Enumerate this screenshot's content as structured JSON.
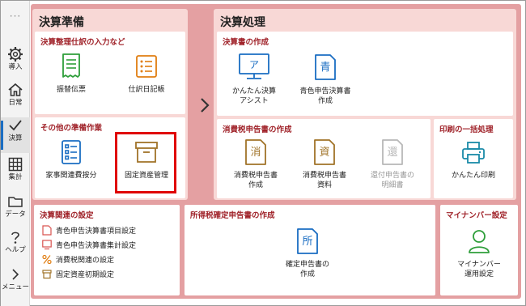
{
  "sidebar": {
    "menu_icon": "more-dots-icon",
    "items": [
      {
        "label": "導入",
        "icon": "gear-icon"
      },
      {
        "label": "日常",
        "icon": "home-icon"
      },
      {
        "label": "決算",
        "icon": "check-icon"
      },
      {
        "label": "集計",
        "icon": "table-icon"
      },
      {
        "label": "データ",
        "icon": "folder-icon"
      },
      {
        "label": "ヘルプ",
        "icon": "help-icon"
      },
      {
        "label": "メニュー",
        "icon": "chevron-right-icon"
      }
    ],
    "active": "決算"
  },
  "kessan_junbi": {
    "title": "決算準備",
    "siwake": {
      "title": "決算整理仕訳の入力など",
      "tiles": [
        {
          "label": "振替伝票",
          "icon": "receipt-icon"
        },
        {
          "label": "仕訳日記帳",
          "icon": "journal-list-icon"
        }
      ]
    },
    "other": {
      "title": "その他の準備作業",
      "tiles": [
        {
          "label": "家事関連費按分",
          "icon": "checklist-icon"
        },
        {
          "label": "固定資産管理",
          "icon": "box-icon"
        }
      ]
    }
  },
  "kessan_shori": {
    "title": "決算処理",
    "sakusei": {
      "title": "決算書の作成",
      "tiles": [
        {
          "label": "かんたん決算\nアシスト",
          "glyph": "ア",
          "icon": "monitor-icon"
        },
        {
          "label": "青色申告決算書\n作成",
          "glyph": "青",
          "icon": "document-icon"
        }
      ]
    },
    "shohizei": {
      "title": "消費税申告書の作成",
      "tiles": [
        {
          "label": "消費税申告書\n作成",
          "glyph": "消",
          "icon": "document-icon"
        },
        {
          "label": "消費税申告書\n資料",
          "glyph": "資",
          "icon": "document-icon"
        },
        {
          "label": "還付申告書の\n明細書",
          "glyph": "還",
          "icon": "document-icon",
          "disabled": true
        }
      ]
    },
    "print": {
      "title": "印刷の一括処理",
      "tiles": [
        {
          "label": "かんたん印刷",
          "icon": "printer-icon"
        }
      ]
    }
  },
  "bottom": {
    "settings": {
      "title": "決算関連の設定",
      "links": [
        {
          "label": "青色申告決算書項目設定",
          "icon": "document-edit-icon"
        },
        {
          "label": "青色申告決算書集計設定",
          "icon": "screen-edit-icon"
        },
        {
          "label": "消費税関連の設定",
          "icon": "percent-icon"
        },
        {
          "label": "固定資産初期設定",
          "icon": "box-small-icon"
        }
      ]
    },
    "shotoku": {
      "title": "所得税確定申告書の作成",
      "tiles": [
        {
          "label": "確定申告書の\n作成",
          "glyph": "所",
          "icon": "document-icon"
        }
      ]
    },
    "mynumber": {
      "title": "マイナンバー設定",
      "tiles": [
        {
          "label": "マイナンバー\n運用設定",
          "icon": "person-icon"
        }
      ]
    }
  },
  "colors": {
    "main_bg": "#e4a0a2",
    "section_bg": "#f8d8d6",
    "panel_title": "#a0232a",
    "icon_blue": "#1a6dc2",
    "icon_green": "#2e9e3a",
    "icon_orange": "#e07d10",
    "icon_tan": "#a07328",
    "highlight": "#e00000"
  }
}
